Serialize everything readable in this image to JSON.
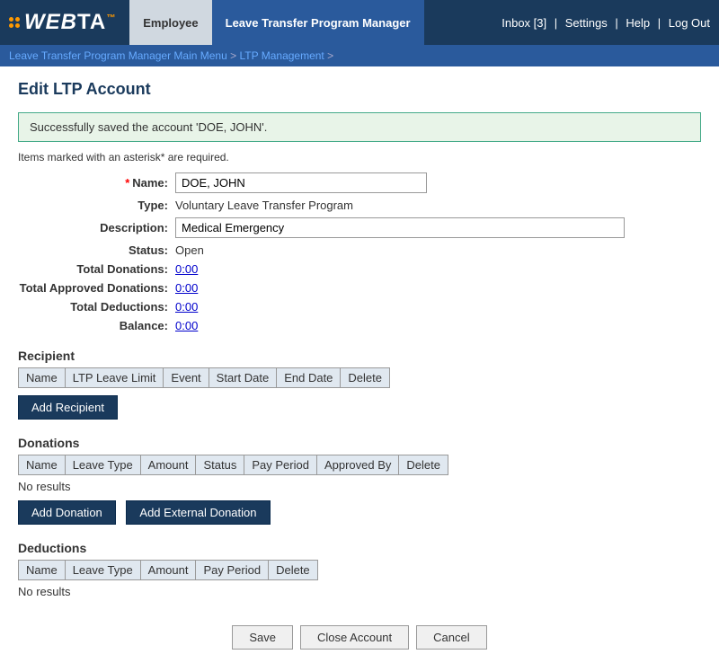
{
  "header": {
    "logo": "WEBTA",
    "logo_tm": "™",
    "nav": {
      "employee_label": "Employee",
      "ltpm_label": "Leave Transfer Program Manager"
    },
    "right": {
      "inbox": "Inbox [3]",
      "settings": "Settings",
      "help": "Help",
      "logout": "Log Out"
    }
  },
  "breadcrumb": {
    "items": [
      "Leave Transfer Program Manager Main Menu",
      "LTP Management"
    ]
  },
  "page": {
    "title": "Edit LTP Account"
  },
  "success": {
    "message": "Successfully saved the account 'DOE, JOHN'."
  },
  "form": {
    "required_note": "Items marked with an asterisk* are required.",
    "name_label": "Name:",
    "name_required": "*",
    "name_value": "DOE, JOHN",
    "type_label": "Type:",
    "type_value": "Voluntary Leave Transfer Program",
    "description_label": "Description:",
    "description_value": "Medical Emergency",
    "status_label": "Status:",
    "status_value": "Open",
    "total_donations_label": "Total Donations:",
    "total_donations_value": "0:00",
    "total_approved_label": "Total Approved Donations:",
    "total_approved_value": "0:00",
    "total_deductions_label": "Total Deductions:",
    "total_deductions_value": "0:00",
    "balance_label": "Balance:",
    "balance_value": "0:00"
  },
  "recipient": {
    "section_title": "Recipient",
    "columns": [
      "Name",
      "LTP Leave Limit",
      "Event",
      "Start Date",
      "End Date",
      "Delete"
    ],
    "add_button": "Add Recipient"
  },
  "donations": {
    "section_title": "Donations",
    "columns": [
      "Name",
      "Leave Type",
      "Amount",
      "Status",
      "Pay Period",
      "Approved By",
      "Delete"
    ],
    "no_results": "No results",
    "add_button": "Add Donation",
    "add_external_button": "Add External Donation"
  },
  "deductions": {
    "section_title": "Deductions",
    "columns": [
      "Name",
      "Leave Type",
      "Amount",
      "Pay Period",
      "Delete"
    ],
    "no_results": "No results"
  },
  "footer": {
    "save_label": "Save",
    "close_account_label": "Close Account",
    "cancel_label": "Cancel"
  }
}
